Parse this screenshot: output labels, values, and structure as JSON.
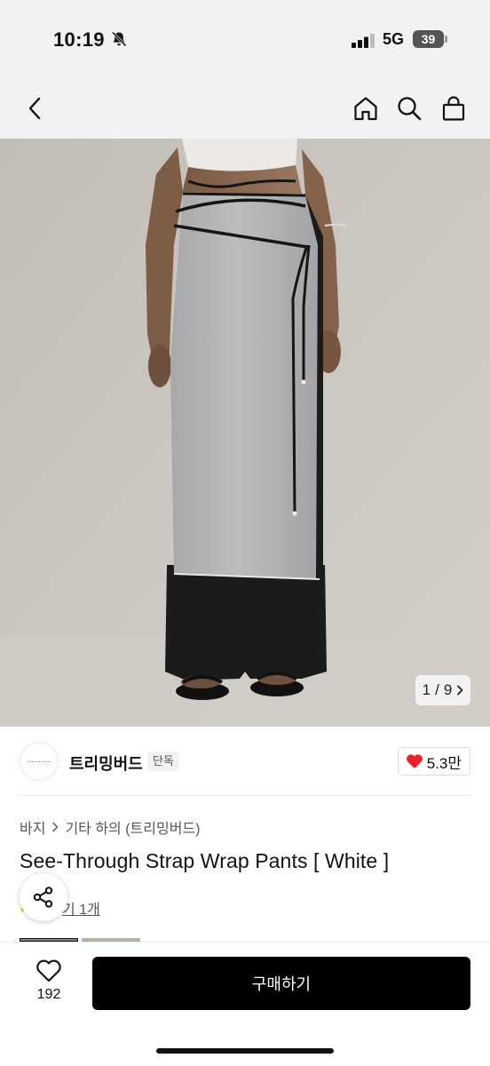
{
  "status_bar": {
    "time": "10:19",
    "network": "5G",
    "battery": "39",
    "icons": [
      "bell-muted-icon",
      "signal-icon"
    ]
  },
  "nav": {
    "icons": [
      "chevron-left-icon",
      "home-icon",
      "search-icon",
      "shopping-bag-icon"
    ]
  },
  "gallery": {
    "current": "1",
    "separator": "/",
    "total": "9"
  },
  "shop": {
    "name": "트리밍버드",
    "badge": "단독",
    "likes": "5.3만",
    "like_color": "#e8202a"
  },
  "product": {
    "breadcrumb": [
      "바지",
      "기타 하의 (트리밍버드)"
    ],
    "title": "See-Through Strap Wrap Pants [ White ]",
    "review_text": "기 1개"
  },
  "bottom_bar": {
    "wish_count": "192",
    "buy_label": "구매하기"
  }
}
